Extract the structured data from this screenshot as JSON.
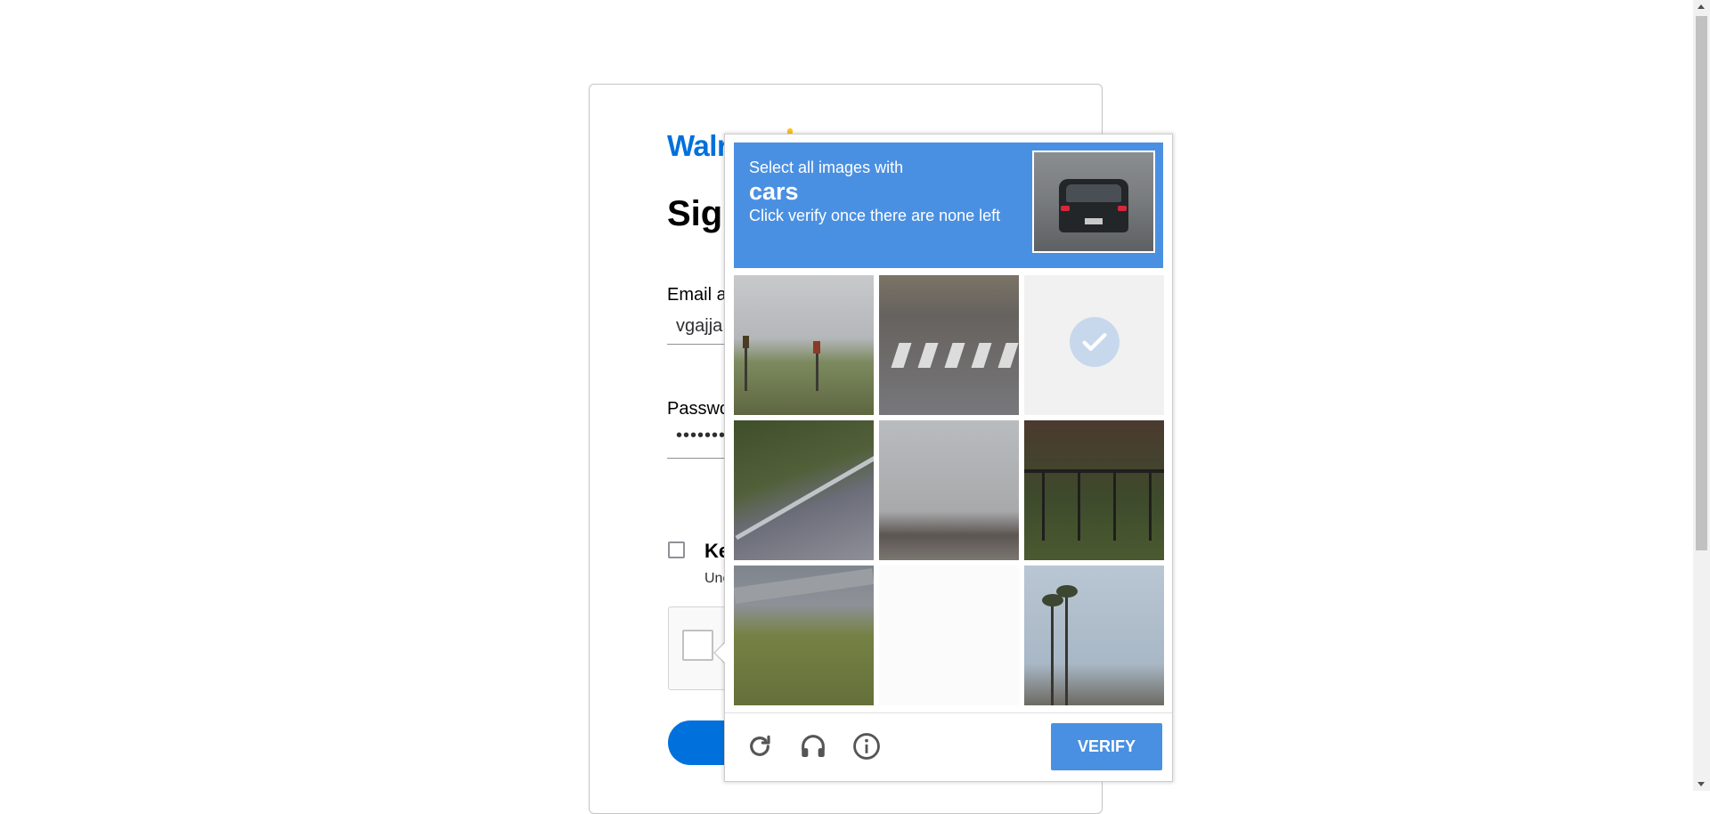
{
  "signin": {
    "logo_text": "Walmart",
    "heading": "Sign in",
    "email_label": "Email address",
    "email_value": "vgajja",
    "password_label": "Password",
    "password_value": "••••••••",
    "keep_label": "Keep me signed in",
    "keep_sub": "Uncheck if using a public device"
  },
  "challenge": {
    "line1": "Select all images with",
    "target": "cars",
    "line3": "Click verify once there are none left",
    "verify_label": "VERIFY",
    "tiles_selected": [
      false,
      false,
      true,
      false,
      false,
      false,
      false,
      false,
      false
    ]
  },
  "icons": [
    "reload-icon",
    "headphones-icon",
    "info-icon"
  ],
  "colors": {
    "accent": "#4a90e2",
    "walmart_blue": "#0071dc",
    "walmart_spark": "#ffc220"
  }
}
